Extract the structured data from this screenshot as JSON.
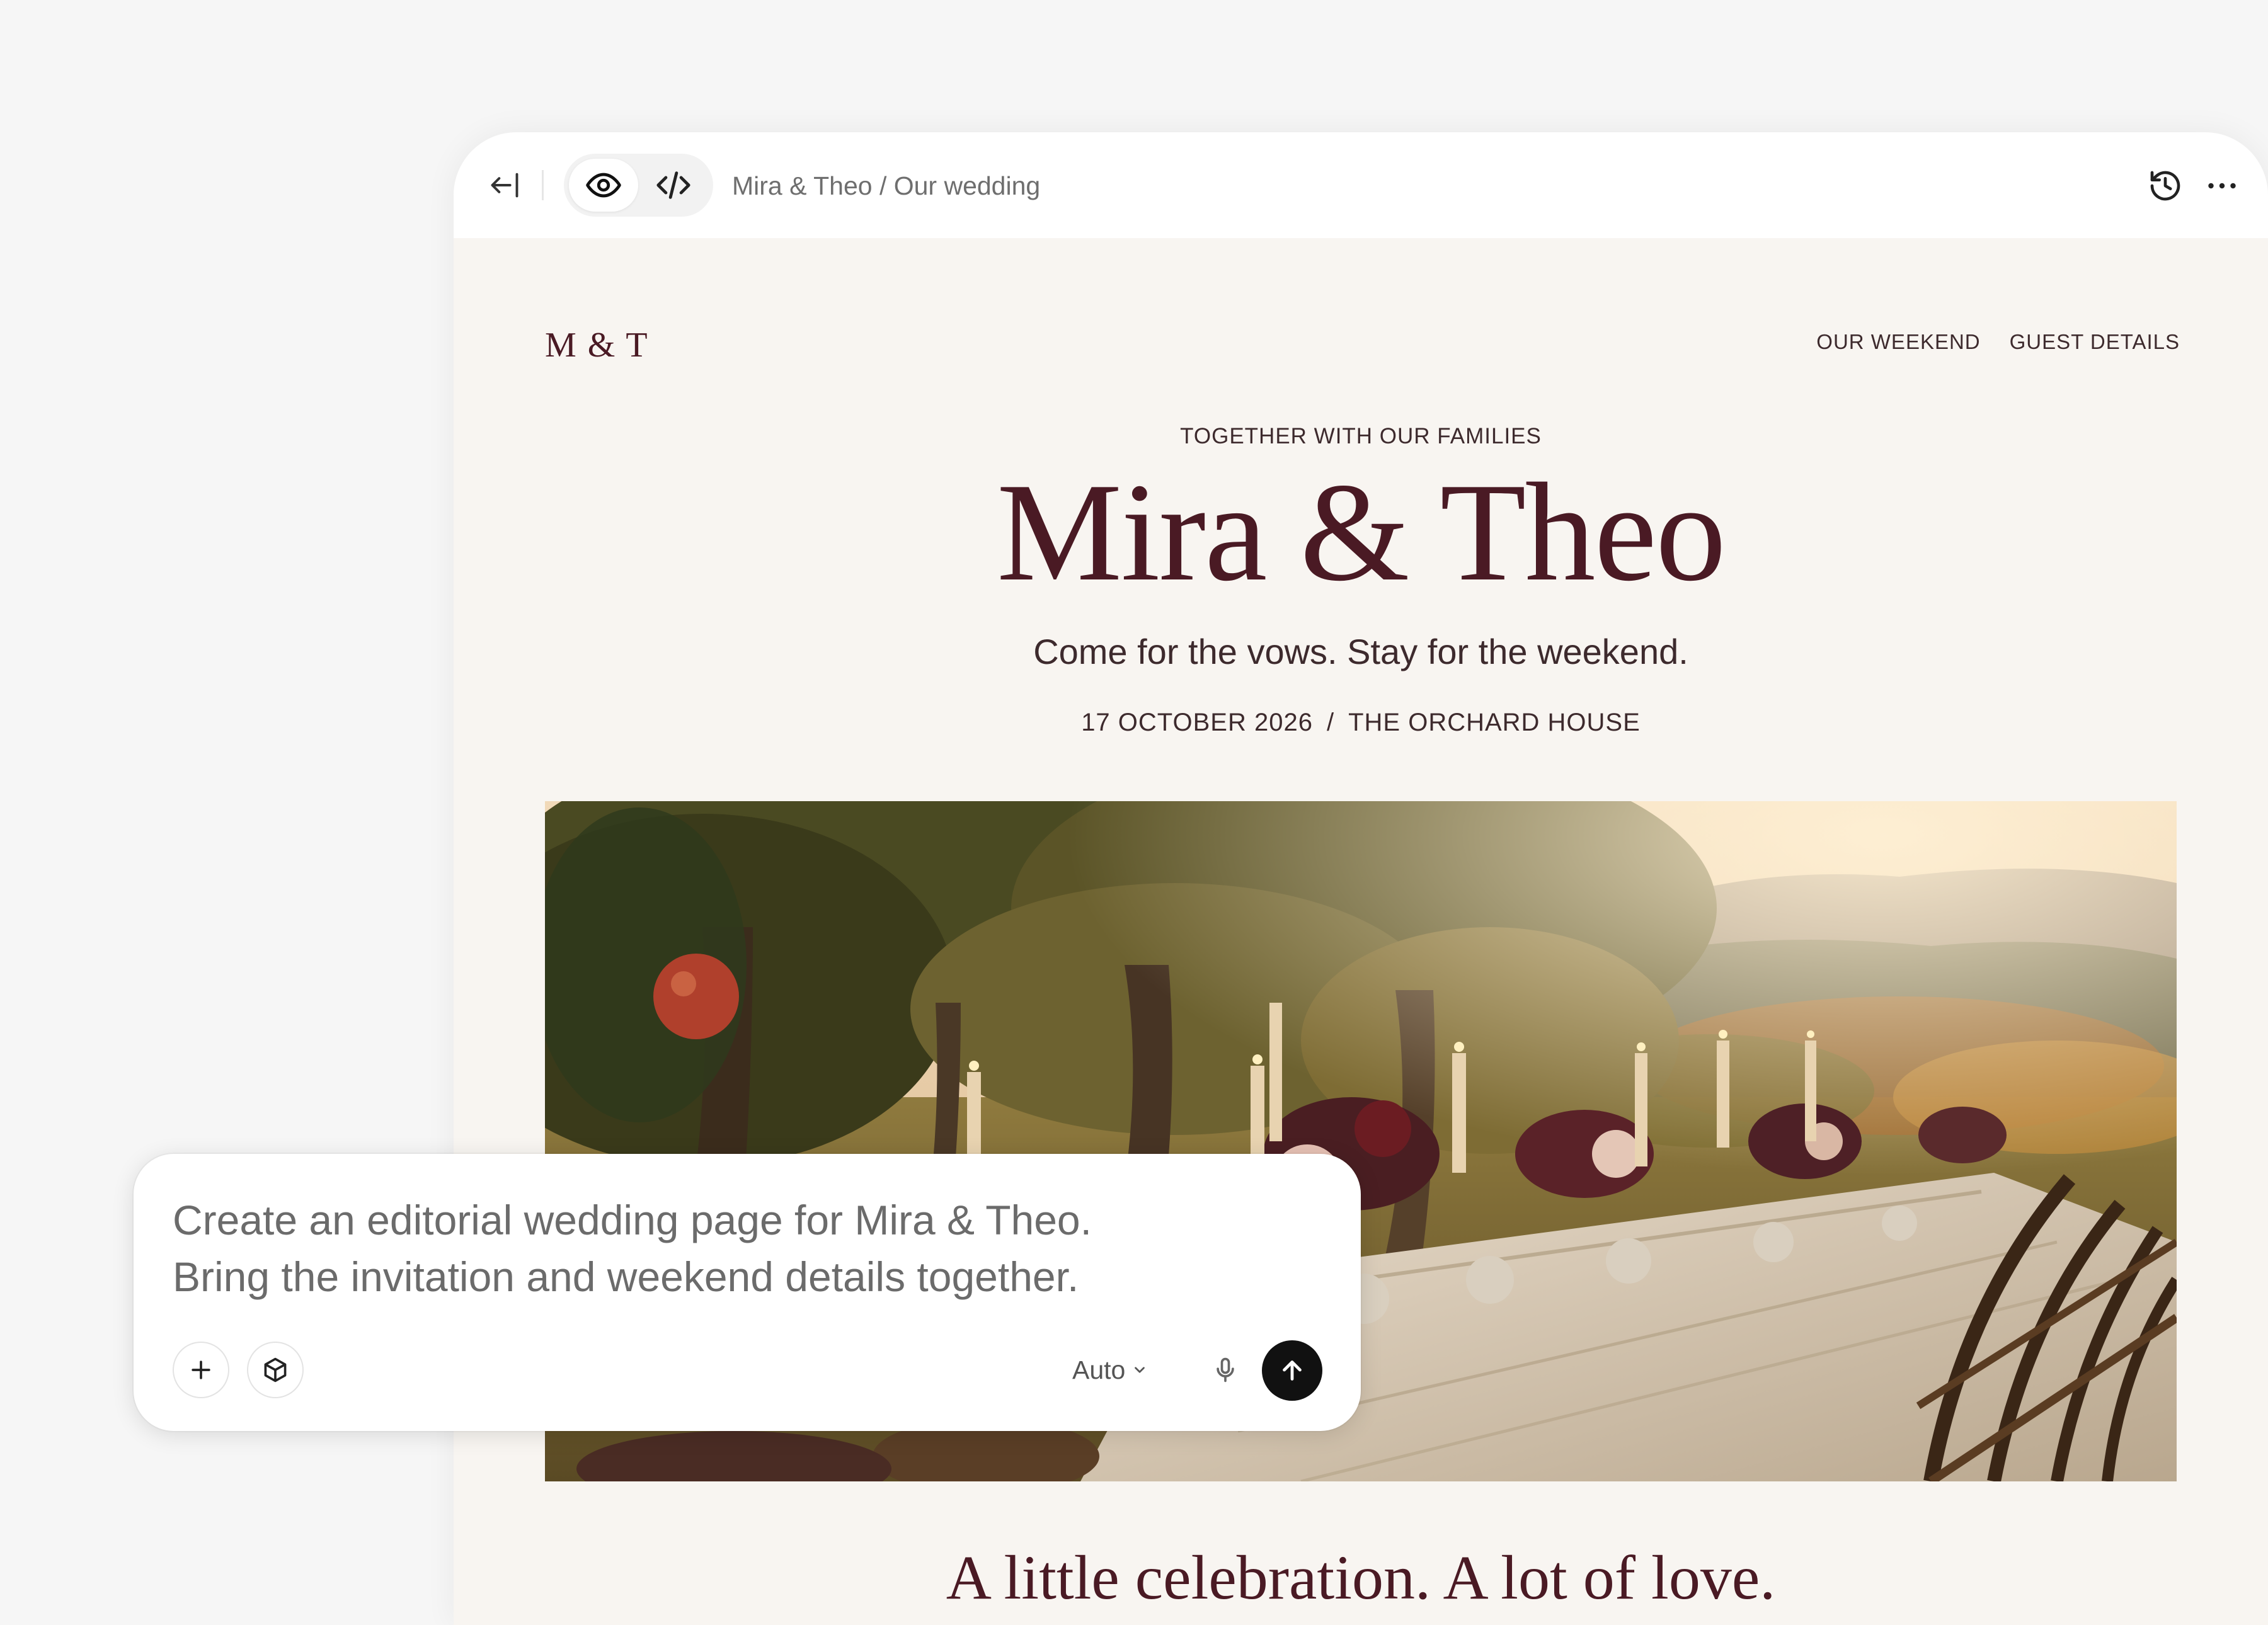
{
  "toolbar": {
    "collapse_icon": "collapse-sidebar-icon",
    "preview_icon": "eye-icon",
    "code_icon": "code-icon",
    "breadcrumb": "Mira & Theo / Our wedding",
    "history_icon": "history-icon",
    "more_icon": "more-horizontal-icon"
  },
  "site": {
    "logo": "M & T",
    "nav": [
      "OUR WEEKEND",
      "GUEST DETAILS"
    ],
    "kicker": "TOGETHER WITH OUR FAMILIES",
    "names": "Mira & Theo",
    "tagline": "Come for the vows. Stay for the weekend.",
    "date": "17 OCTOBER 2026",
    "date_separator": "/",
    "venue": "THE ORCHARD HOUSE",
    "section_heading": "A little celebration. A lot of love."
  },
  "composer": {
    "prompt_line1": "Create an editorial wedding page for Mira & Theo.",
    "prompt_line2": "Bring the invitation and weekend details together.",
    "add_icon": "plus-icon",
    "component_icon": "cube-icon",
    "model": "Auto",
    "chevron_icon": "chevron-down-icon",
    "mic_icon": "microphone-icon",
    "send_icon": "arrow-up-icon"
  },
  "colors": {
    "accent": "#4a1a24",
    "page_bg": "#f8f5f1",
    "send_button": "#111111"
  }
}
